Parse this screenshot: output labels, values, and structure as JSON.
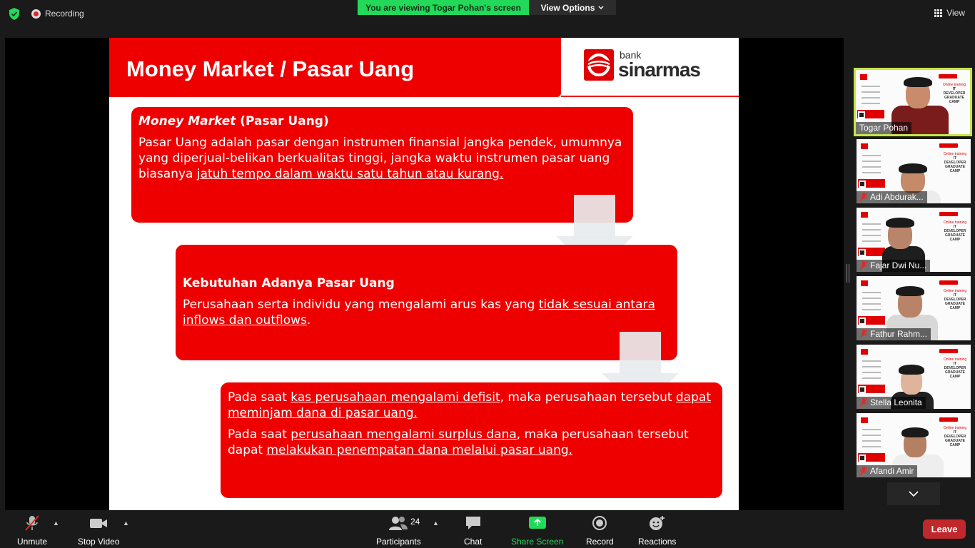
{
  "topbar": {
    "recording_label": "Recording",
    "viewing_banner": "You are viewing Togar Pohan's screen",
    "view_options_label": "View Options",
    "view_label": "View"
  },
  "slide": {
    "title": "Money Market / Pasar Uang",
    "logo_small": "bank",
    "logo_big": "sinarmas",
    "box1": {
      "title_italic": "Money Market",
      "title_rest": " (Pasar Uang)",
      "text_plain": "Pasar Uang adalah pasar dengan instrumen finansial jangka pendek, umumnya yang diperjual-belikan berkualitas tinggi, jangka waktu instrumen pasar uang biasanya ",
      "text_underline": "jatuh tempo dalam waktu satu tahun atau kurang."
    },
    "box2": {
      "title": "Kebutuhan Adanya Pasar Uang",
      "text_plain": "Perusahaan serta individu yang mengalami arus kas yang ",
      "text_underline": "tidak sesuai antara inflows dan outflows",
      "text_end": "."
    },
    "box3": {
      "p1_a": "Pada saat ",
      "p1_u1": "kas perusahaan mengalami defisit",
      "p1_b": ", maka perusahaan tersebut ",
      "p1_u2": "dapat meminjam dana di pasar uang.",
      "p2_a": "Pada saat ",
      "p2_u1": "perusahaan mengalami surplus dana",
      "p2_b": ", maka perusahaan tersebut dapat ",
      "p2_u2": "melakukan penempatan dana melalui pasar uang."
    },
    "thumb_text_red": "Online training",
    "thumb_text_bold": "IT DEVELOPER GRADUATE CAMP"
  },
  "participants": [
    {
      "name": "Togar Pohan",
      "muted": false
    },
    {
      "name": "Adi Abdurak...",
      "muted": true
    },
    {
      "name": "Fajar Dwi Nu...",
      "muted": true
    },
    {
      "name": "Fathur Rahm...",
      "muted": true
    },
    {
      "name": "Stella Leonita",
      "muted": true
    },
    {
      "name": "Afandi Amir",
      "muted": true
    }
  ],
  "toolbar": {
    "unmute_label": "Unmute",
    "stop_video_label": "Stop Video",
    "participants_label": "Participants",
    "participants_count": "24",
    "chat_label": "Chat",
    "share_screen_label": "Share Screen",
    "record_label": "Record",
    "reactions_label": "Reactions",
    "leave_label": "Leave"
  },
  "colors": {
    "slide_red": "#ee0000",
    "banner_green": "#23d959",
    "active_border": "#c6e54a",
    "leave_red": "#c0282c"
  }
}
